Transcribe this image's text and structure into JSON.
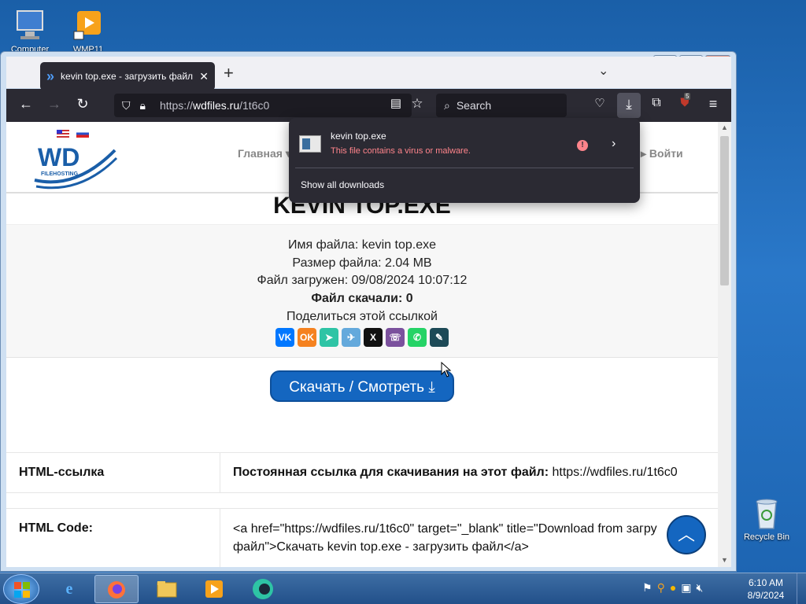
{
  "desktop": {
    "icons": [
      {
        "label": "Computer"
      },
      {
        "label": "WMP11"
      },
      {
        "label": "Recycle Bin"
      }
    ]
  },
  "browser": {
    "tab_title": "kevin top.exe - загрузить файл",
    "url_scheme": "https://",
    "url_host": "wdfiles.ru",
    "url_path": "/1t6c0",
    "search_placeholder": "Search",
    "extension_badge": "5"
  },
  "download_panel": {
    "file_name": "kevin top.exe",
    "warning": "This file contains a virus or malware.",
    "show_all": "Show all downloads"
  },
  "site": {
    "logo_text": "WD",
    "logo_sub": "FILEHOSTING",
    "nav_home": "Главная ▾",
    "nav_login": "Войти",
    "file_title": "KEVIN TOP.EXE",
    "file_name_line": "Имя файла: kevin top.exe",
    "file_size_line": "Размер файла: 2.04 MB",
    "uploaded_line": "Файл загружен: 09/08/2024 10:07:12",
    "downloads_line": "Файл скачали: 0",
    "share_line": "Поделиться этой ссылкой",
    "share_icons": [
      "vk-icon",
      "ok-icon",
      "send-icon",
      "telegram-icon",
      "x-icon",
      "viber-icon",
      "whatsapp-icon",
      "livejournal-icon"
    ],
    "download_button": "Скачать / Смотреть",
    "rows": [
      {
        "key": "HTML-ссылка",
        "value_bold": "Постоянная ссылка для скачивания на этот файл:",
        "value": " https://wdfiles.ru/1t6c0"
      },
      {
        "key": "HTML Code:",
        "value_bold": "",
        "value": "<a href=\"https://wdfiles.ru/1t6c0\" target=\"_blank\" title=\"Download from загру файл\">Скачать kevin top.exe - загрузить файл</a>"
      }
    ]
  },
  "taskbar": {
    "time": "6:10 AM",
    "date": "8/9/2024"
  },
  "colors": {
    "accent": "#1466c0",
    "panel_bg": "#2b2a33",
    "warning": "#ff848b"
  }
}
